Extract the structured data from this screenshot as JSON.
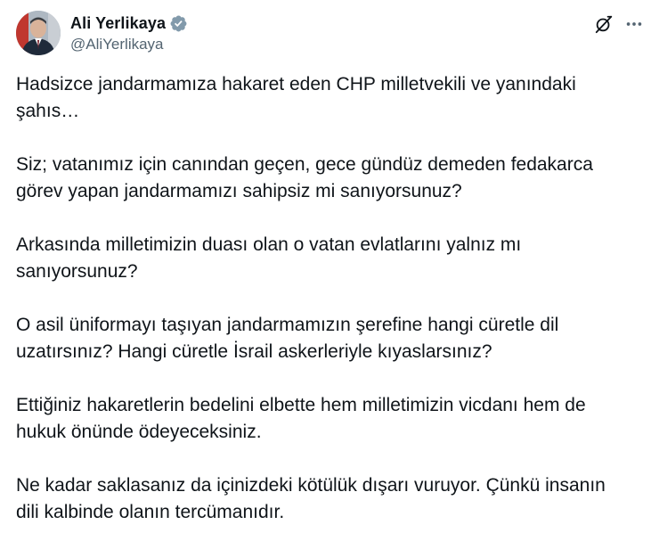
{
  "author": {
    "display_name": "Ali Yerlikaya",
    "handle": "@AliYerlikaya",
    "avatar_icon": "profile-photo",
    "verified_icon": "verified-badge-icon",
    "verified_color": "#829aab"
  },
  "actions": {
    "grok_icon": "grok-icon",
    "more_icon": "more-options-icon"
  },
  "tweet": {
    "paragraphs": [
      "Hadsizce jandarmamıza hakaret eden CHP milletvekili ve yanındaki\nşahıs…",
      "Siz; vatanımız için canından geçen, gece gündüz demeden fedakarca\ngörev yapan jandarmamızı sahipsiz mi sanıyorsunuz?",
      "Arkasında milletimizin duası olan o vatan evlatlarını yalnız mı\nsanıyorsunuz?",
      "O asil üniformayı taşıyan jandarmamızın şerefine hangi cüretle dil\nuzatırsınız? Hangi cüretle İsrail askerleriyle kıyaslarsınız?",
      "Ettiğiniz hakaretlerin bedelini elbette hem milletimizin vicdanı hem de\nhukuk önünde ödeyeceksiniz.",
      "Ne kadar saklasanız da içinizdeki kötülük dışarı vuruyor. Çünkü insanın\ndili kalbinde olanın tercümanıdır."
    ]
  },
  "colors": {
    "text_primary": "#0f1419",
    "text_secondary": "#536471",
    "background": "#ffffff"
  }
}
